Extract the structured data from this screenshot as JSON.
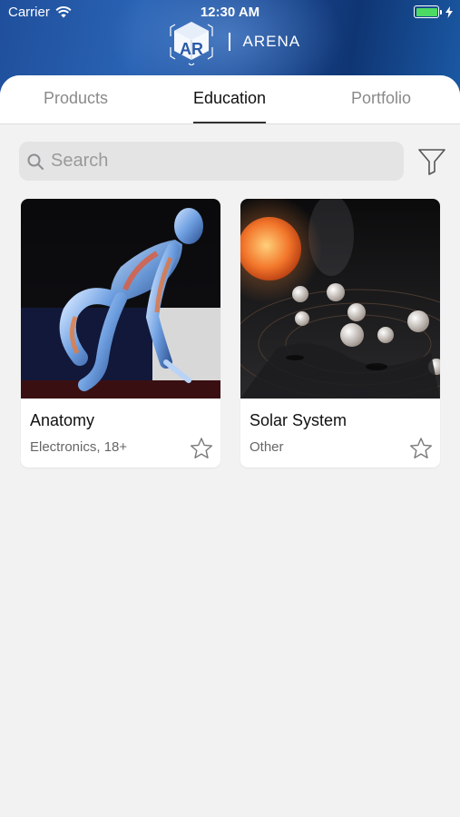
{
  "status_bar": {
    "carrier": "Carrier",
    "time": "12:30 AM"
  },
  "header": {
    "app_name": "ARENA",
    "logo_text": "AR",
    "logo_icon": "ar-cube-logo"
  },
  "tabs": [
    {
      "label": "Products",
      "active": false
    },
    {
      "label": "Education",
      "active": true
    },
    {
      "label": "Portfolio",
      "active": false
    }
  ],
  "search": {
    "placeholder": "Search",
    "icon": "search-icon"
  },
  "filter": {
    "icon": "filter-funnel-icon"
  },
  "cards": [
    {
      "title": "Anatomy",
      "subtitle": "Electronics, 18+",
      "image": "anatomy-runner-illustration",
      "favorite": false
    },
    {
      "title": "Solar System",
      "subtitle": "Other",
      "image": "solar-system-planets-illustration",
      "favorite": false
    }
  ],
  "colors": {
    "header_blue": "#1f4f9c",
    "background": "#f2f2f2",
    "battery_green": "#4cd964",
    "active_tab_text": "#111111",
    "inactive_tab_text": "#8a8a8a"
  }
}
